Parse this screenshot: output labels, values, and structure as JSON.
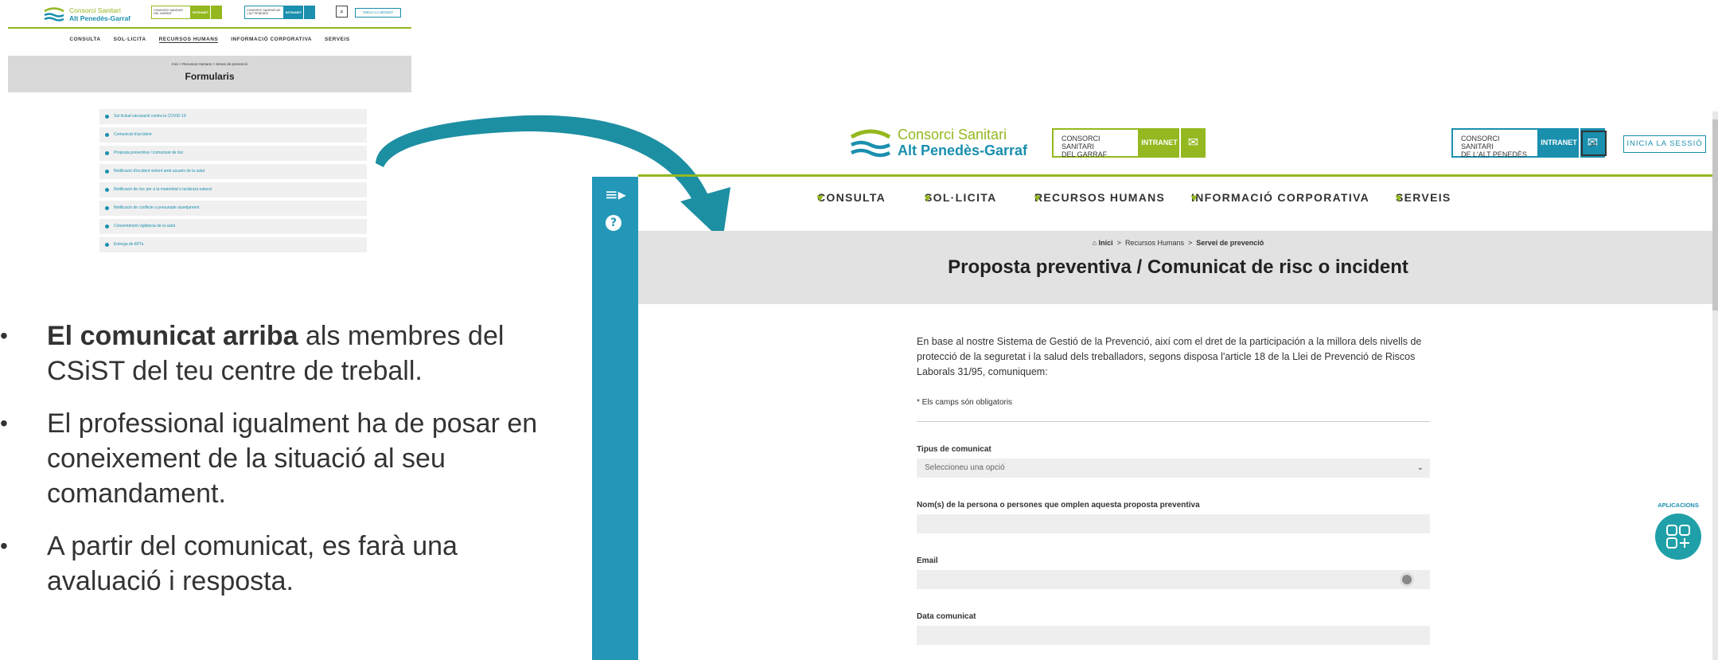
{
  "mini": {
    "logo_line1": "Consorci Sanitari",
    "logo_line2": "Alt Penedès-Garraf",
    "box1_text": "CONSORCI SANITARI DEL GARRAF",
    "box1_intranet": "INTRANET",
    "box2_text": "CONSORCI SANITARI DE L'ALT PENEDÈS",
    "box2_intranet": "INTRANET",
    "login": "INICIA LA SESSIÓ",
    "nav": [
      "CONSULTA",
      "SOL·LICITA",
      "RECURSOS HUMANS",
      "INFORMACIÓ CORPORATIVA",
      "SERVEIS"
    ],
    "breadcrumb": "Inici  >  Recursos Humans  >  Servei de prevenció",
    "title": "Formularis",
    "list": [
      "Sol·licitud vacunació contra la COVID-19",
      "Comunicat d'accident",
      "Proposta preventiva / comunicat de risc",
      "Notificació d'incident violent amb usuaris de la salut",
      "Notificació de risc per a la maternitat o lactància natural",
      "Notificació de conflicte o presumpte assetjament",
      "Consentiment vigilància de la salut",
      "Entrega de EPI's"
    ]
  },
  "bullets": [
    {
      "strong": "El comunicat arriba",
      "rest": " als membres del CSiST del teu centre de treball."
    },
    {
      "strong": "",
      "rest": "El professional igualment ha de posar en coneixement de la situació al seu comandament."
    },
    {
      "strong": "",
      "rest": "A partir del comunicat, es farà una avaluació i resposta."
    }
  ],
  "bullet_char": "•",
  "page": {
    "logo_line1": "Consorci Sanitari",
    "logo_line2": "Alt Penedès-Garraf",
    "box1_line1": "CONSORCI SANITARI",
    "box1_line2": "DEL GARRAF",
    "box1_intranet": "INTRANET",
    "box2_line1": "CONSORCI SANITARI",
    "box2_line2": "DE L'ALT PENEDÈS",
    "box2_intranet": "INTRANET",
    "login": "INICIA LA SESSIÓ",
    "nav": {
      "consulta": "CONSULTA",
      "sollicita": "SOL·LICITA",
      "rrhh": "RECURSOS HUMANS",
      "info": "INFORMACIÓ CORPORATIVA",
      "serveis": "SERVEIS"
    },
    "breadcrumb": {
      "home": "Inici",
      "sep": ">",
      "section": "Recursos Humans",
      "current": "Servei de prevenció"
    },
    "title": "Proposta preventiva / Comunicat de risc o incident",
    "intro": "En base al nostre Sistema de Gestió de la Prevenció, així com el dret de la participación a la millora dels nivells de protecció de la seguretat i la salud dels treballadors, segons disposa l'article 18 de la Llei de Prevenció de Riscos Laborals 31/95, comuniquem:",
    "required_note": "* Els camps són obligatoris",
    "fields": {
      "tipus_label": "Tipus de comunicat",
      "tipus_value": "Seleccioneu una opció",
      "noms_label": "Nom(s) de la persona o persones que omplen aquesta proposta preventiva",
      "email_label": "Email",
      "data_label": "Data comunicat"
    },
    "apps_label": "APLICACIONS"
  },
  "colors": {
    "green": "#94b81f",
    "teal": "#1a8fae",
    "sidebar": "#2397b7",
    "arrow": "#1d8fa2"
  }
}
